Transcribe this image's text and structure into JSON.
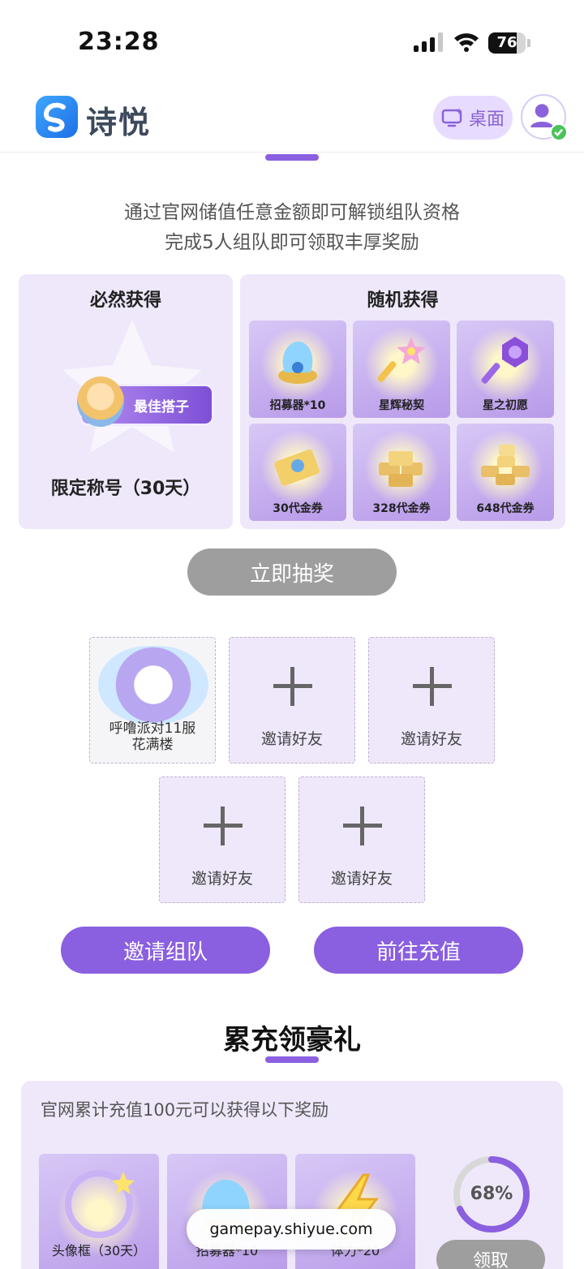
{
  "status_bar": {
    "time": "23:28",
    "battery": "76",
    "battery_level": 0.76
  },
  "header": {
    "brand": "诗悦",
    "desktop_label": "桌面"
  },
  "intro": {
    "line1": "通过官网储值任意金额即可解锁组队资格",
    "line2": "完成5人组队即可领取丰厚奖励"
  },
  "guaranteed": {
    "title": "必然获得",
    "badge_text": "最佳搭子",
    "label": "限定称号（30天）"
  },
  "random": {
    "title": "随机获得",
    "items": [
      {
        "label": "招募器*10",
        "icon": "recruiter-icon"
      },
      {
        "label": "星辉秘契",
        "icon": "star-key-icon"
      },
      {
        "label": "星之初愿",
        "icon": "purple-key-icon"
      },
      {
        "label": "30代金券",
        "icon": "voucher-icon"
      },
      {
        "label": "328代金券",
        "icon": "voucher-stack-icon"
      },
      {
        "label": "648代金券",
        "icon": "voucher-pile-icon"
      }
    ]
  },
  "draw_button": "立即抽奖",
  "team": {
    "member": {
      "name_line1": "呼噜派对11服",
      "name_line2": "花满楼"
    },
    "invite_label": "邀请好友"
  },
  "actions": {
    "invite_team": "邀请组队",
    "recharge": "前往充值"
  },
  "accumulate": {
    "title": "累充领豪礼",
    "note": "官网累计充值100元可以获得以下奖励",
    "items": [
      {
        "label": "头像框（30天）",
        "icon": "avatar-frame-icon"
      },
      {
        "label": "招募器*10",
        "icon": "recruiter-icon"
      },
      {
        "label": "体力*20",
        "icon": "lightning-icon"
      }
    ],
    "progress_text": "68%",
    "progress_value": 0.68,
    "claim_label": "领取"
  },
  "url_bar": {
    "domain": "gamepay.shiyue.com"
  },
  "colors": {
    "accent": "#8a5fe0",
    "panel": "#efe8fb",
    "disabled": "#9e9e9e"
  }
}
